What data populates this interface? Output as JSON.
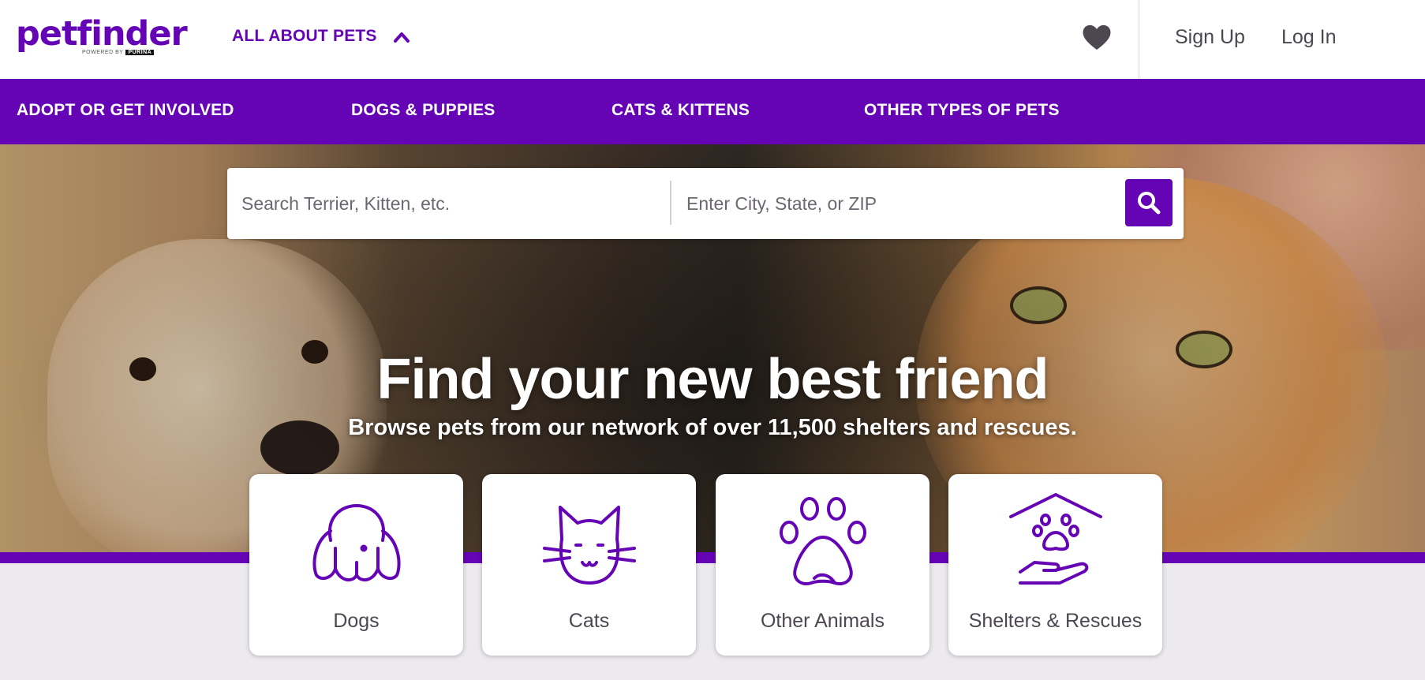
{
  "header": {
    "logo": {
      "word": "petfinder",
      "powered_by": "POWERED BY",
      "brand": "PURINA"
    },
    "about_label": "ALL ABOUT PETS",
    "signup_label": "Sign Up",
    "login_label": "Log In"
  },
  "nav": {
    "items": [
      {
        "label": "ADOPT OR GET INVOLVED"
      },
      {
        "label": "DOGS & PUPPIES"
      },
      {
        "label": "CATS & KITTENS"
      },
      {
        "label": "OTHER TYPES OF PETS"
      }
    ]
  },
  "search": {
    "pet_placeholder": "Search Terrier, Kitten, etc.",
    "location_placeholder": "Enter City, State, or ZIP",
    "pet_value": "",
    "location_value": ""
  },
  "hero": {
    "headline": "Find your new best friend",
    "subline": "Browse pets from our network of over 11,500 shelters and rescues."
  },
  "categories": [
    {
      "label": "Dogs",
      "icon": "dog-icon"
    },
    {
      "label": "Cats",
      "icon": "cat-icon"
    },
    {
      "label": "Other Animals",
      "icon": "paw-icon"
    },
    {
      "label": "Shelters & Rescues",
      "icon": "shelter-icon"
    }
  ],
  "colors": {
    "brand": "#6504b5",
    "text": "#4d4751",
    "background": "#eceaee"
  }
}
